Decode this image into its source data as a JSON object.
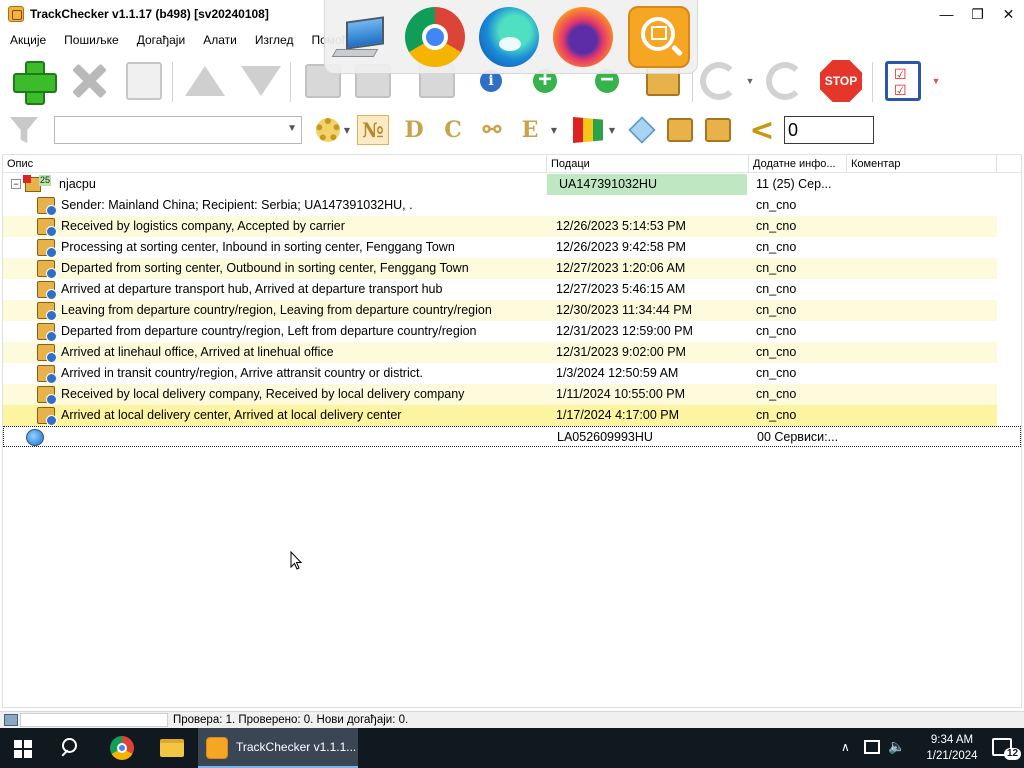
{
  "window": {
    "title": "TrackChecker v1.1.17 (b498)  [sv20240108]",
    "minimize": "—",
    "maximize": "❐",
    "close": "✕"
  },
  "menu": [
    "Акције",
    "Пошиљке",
    "Догађаји",
    "Алати",
    "Изглед",
    "Помоћ"
  ],
  "overlay_icons": [
    "computer-icon",
    "chrome-icon",
    "edge-icon",
    "firefox-icon",
    "trackchecker-icon"
  ],
  "toolbar1": {
    "icons": [
      "add-icon",
      "delete-icon",
      "check-doc-icon",
      "move-up-icon",
      "move-down-icon",
      "cut-icon",
      "copy-icon",
      "paste-icon",
      "info-check-icon",
      "add-package-icon",
      "remove-package-icon",
      "package-check-icon",
      "refresh-icon",
      "refresh-all-icon",
      "stop-icon",
      "checklist-icon"
    ],
    "stop_label": "STOP"
  },
  "toolbar2": {
    "filter_value": "",
    "number_label": "№",
    "d_label": "D",
    "c_label": "C",
    "e_label": "E",
    "lt_label": "<",
    "number_input": "0"
  },
  "columns": {
    "description": "Опис",
    "data": "Подаци",
    "extra": "Додатне инфо...",
    "comment": "Коментар"
  },
  "group": {
    "count": "25",
    "name": "njacpu",
    "data": "UA147391032HU",
    "extra": "11 (25) Сер..."
  },
  "events": [
    {
      "desc": "Sender: Mainland China; Recipient: Serbia; UA147391032HU, .",
      "date": "",
      "extra": "cn_cno"
    },
    {
      "desc": "Received by logistics company, Accepted by carrier",
      "date": "12/26/2023 5:14:53 PM",
      "extra": "cn_cno"
    },
    {
      "desc": "Processing at sorting center, Inbound in sorting center, Fenggang Town",
      "date": "12/26/2023 9:42:58 PM",
      "extra": "cn_cno"
    },
    {
      "desc": "Departed from sorting center, Outbound in sorting center, Fenggang Town",
      "date": "12/27/2023 1:20:06 AM",
      "extra": "cn_cno"
    },
    {
      "desc": "Arrived at departure transport hub, Arrived at departure transport hub",
      "date": "12/27/2023 5:46:15 AM",
      "extra": "cn_cno"
    },
    {
      "desc": "Leaving from departure country/region, Leaving from departure country/region",
      "date": "12/30/2023 11:34:44 PM",
      "extra": "cn_cno"
    },
    {
      "desc": "Departed from departure country/region, Left from departure country/region",
      "date": "12/31/2023 12:59:00 PM",
      "extra": "cn_cno"
    },
    {
      "desc": "Arrived at linehaul office, Arrived at linehual office",
      "date": "12/31/2023 9:02:00 PM",
      "extra": "cn_cno"
    },
    {
      "desc": "Arrived in transit country/region, Arrive attransit country or district.",
      "date": "1/3/2024 12:50:59 AM",
      "extra": "cn_cno"
    },
    {
      "desc": "Received by local delivery company, Received by local delivery company",
      "date": "1/11/2024 10:55:00 PM",
      "extra": "cn_cno"
    },
    {
      "desc": "Arrived at local delivery center, Arrived at local delivery center",
      "date": "1/17/2024 4:17:00 PM",
      "extra": "cn_cno"
    }
  ],
  "second_item": {
    "data": "LA052609993HU",
    "extra": "00 Сервиси:..."
  },
  "statusbar": {
    "text": "Провера: 1. Проверено: 0. Нови догађаји: 0."
  },
  "taskbar": {
    "app_label": "TrackChecker v1.1.1...",
    "time": "9:34 AM",
    "date": "1/21/2024",
    "notifications": "12"
  },
  "colors": {
    "row_alt": "#fdfbdc",
    "row_last": "#fcf4a0",
    "group_data_bg": "#bfe7c2",
    "taskbar": "#101820"
  }
}
